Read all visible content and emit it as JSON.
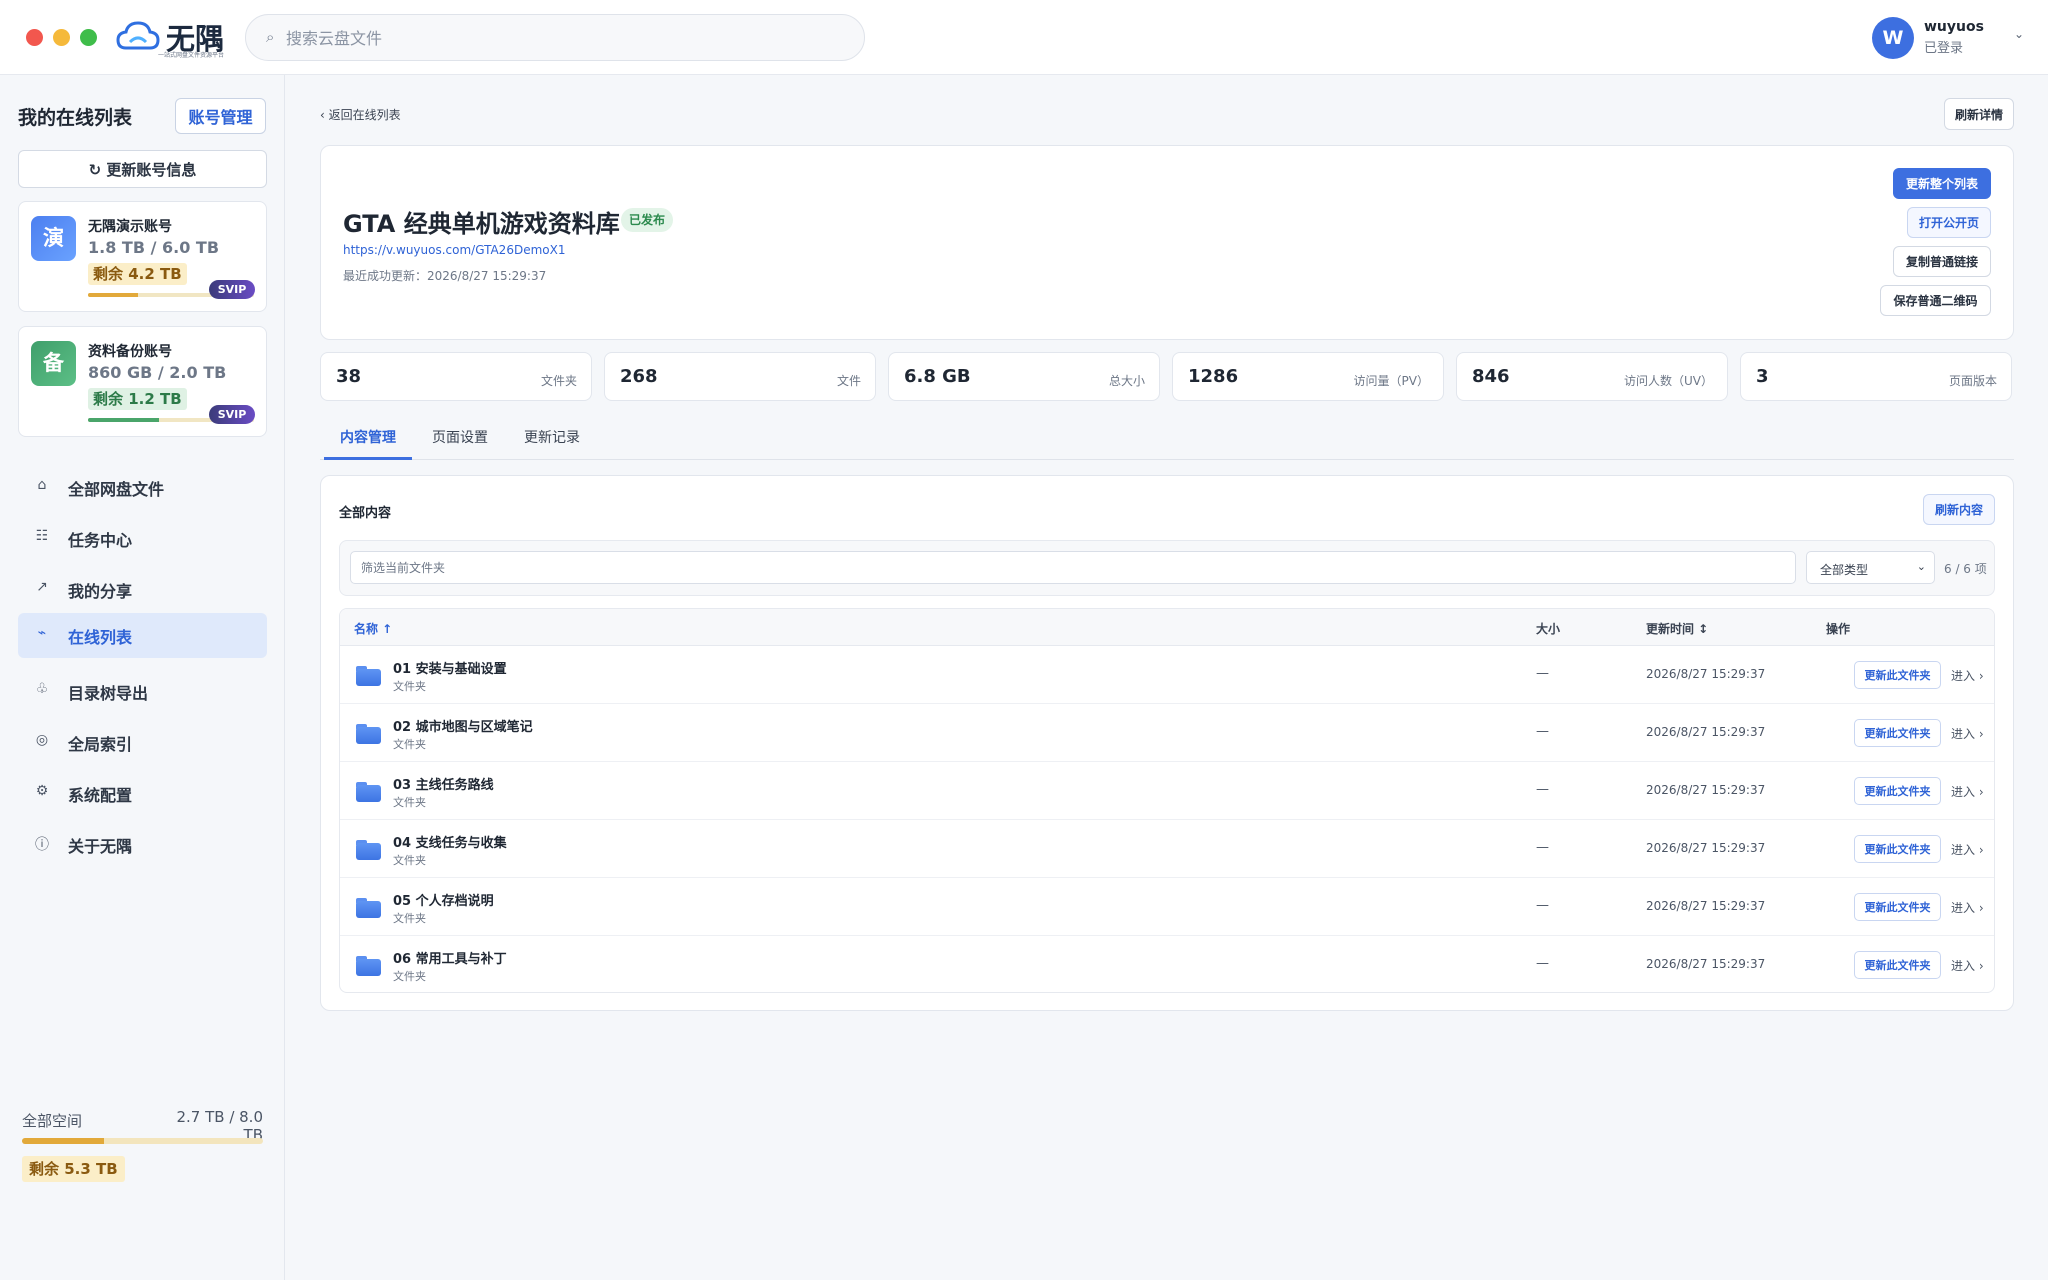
{
  "window": {
    "controls": [
      "close",
      "minimize",
      "zoom"
    ]
  },
  "brand": {
    "name": "无隅",
    "tagline": "一站式网盘文件资源平台",
    "icon": "cloud-logo-icon"
  },
  "search": {
    "placeholder": "搜索云盘文件",
    "icon": "search-icon"
  },
  "user": {
    "initial": "W",
    "name": "wuyuos",
    "status": "已登录"
  },
  "sidebar": {
    "title": "我的在线列表",
    "account_button": "账号管理",
    "refresh_button": "更新账号信息",
    "accounts": [
      {
        "badge": "演",
        "name": "无隅演示账号",
        "usage": "1.8 TB / 6.0 TB",
        "free": "剩余 4.2 TB",
        "used_fraction": 0.3,
        "tier": "SVIP"
      },
      {
        "badge": "备",
        "name": "资料备份账号",
        "usage": "860 GB / 2.0 TB",
        "free": "剩余 1.2 TB",
        "used_fraction": 0.43,
        "tier": "SVIP"
      }
    ],
    "nav": [
      {
        "label": "全部网盘文件",
        "icon": "home-icon",
        "glyph": "⌂",
        "active": false
      },
      {
        "label": "任务中心",
        "icon": "task-list-icon",
        "glyph": "☷",
        "active": false
      },
      {
        "label": "我的分享",
        "icon": "share-arrow-icon",
        "glyph": "↗",
        "active": false
      },
      {
        "label": "在线列表",
        "icon": "online-list-icon",
        "glyph": "⌁",
        "active": true
      },
      {
        "label": "目录树导出",
        "icon": "tree-export-icon",
        "glyph": "♧",
        "active": false
      },
      {
        "label": "全局索引",
        "icon": "index-icon",
        "glyph": "◎",
        "active": false
      },
      {
        "label": "系统配置",
        "icon": "gear-icon",
        "glyph": "⚙",
        "active": false
      },
      {
        "label": "关于无隅",
        "icon": "info-icon",
        "glyph": "ⓘ",
        "active": false
      }
    ],
    "space": {
      "label": "全部空间",
      "value": "2.7 TB / 8.0 TB",
      "used_fraction": 0.34,
      "free": "剩余 5.3 TB"
    }
  },
  "main": {
    "back_label": "返回在线列表",
    "refresh_detail_label": "刷新详情",
    "hero": {
      "title": "GTA 经典单机游戏资料库",
      "status": "已发布",
      "url": "https://v.wuyuos.com/GTA26DemoX1",
      "updated": "最近成功更新：2026/8/27 15:29:37",
      "buttons": {
        "update_all": "更新整个列表",
        "open_public": "打开公开页",
        "copy_link": "复制普通链接",
        "save_qr": "保存普通二维码"
      }
    },
    "stats": [
      {
        "value": "38",
        "label": "文件夹"
      },
      {
        "value": "268",
        "label": "文件"
      },
      {
        "value": "6.8 GB",
        "label": "总大小"
      },
      {
        "value": "1286",
        "label": "访问量（PV）"
      },
      {
        "value": "846",
        "label": "访问人数（UV）"
      },
      {
        "value": "3",
        "label": "页面版本"
      }
    ],
    "tabs": [
      {
        "label": "内容管理",
        "active": true
      },
      {
        "label": "页面设置",
        "active": false
      },
      {
        "label": "更新记录",
        "active": false
      }
    ],
    "content": {
      "title": "全部内容",
      "refresh_button": "刷新内容",
      "filter_placeholder": "筛选当前文件夹",
      "type_select": "全部类型",
      "count": "6 / 6 项",
      "columns": {
        "name": "名称 ↑",
        "size": "大小",
        "time": "更新时间 ↕",
        "ops": "操作"
      },
      "update_label": "更新此文件夹",
      "enter_label": "进入 ›",
      "rows": [
        {
          "name": "01 安装与基础设置",
          "type": "文件夹",
          "size": "—",
          "time": "2026/8/27 15:29:37"
        },
        {
          "name": "02 城市地图与区域笔记",
          "type": "文件夹",
          "size": "—",
          "time": "2026/8/27 15:29:37"
        },
        {
          "name": "03 主线任务路线",
          "type": "文件夹",
          "size": "—",
          "time": "2026/8/27 15:29:37"
        },
        {
          "name": "04 支线任务与收集",
          "type": "文件夹",
          "size": "—",
          "time": "2026/8/27 15:29:37"
        },
        {
          "name": "05 个人存档说明",
          "type": "文件夹",
          "size": "—",
          "time": "2026/8/27 15:29:37"
        },
        {
          "name": "06 常用工具与补丁",
          "type": "文件夹",
          "size": "—",
          "time": "2026/8/27 15:29:37"
        }
      ]
    }
  },
  "colors": {
    "accent": "#3d6fe0",
    "success": "#2c8a4e",
    "warning": "#e2a93a",
    "svip": "#6a4cc4"
  }
}
